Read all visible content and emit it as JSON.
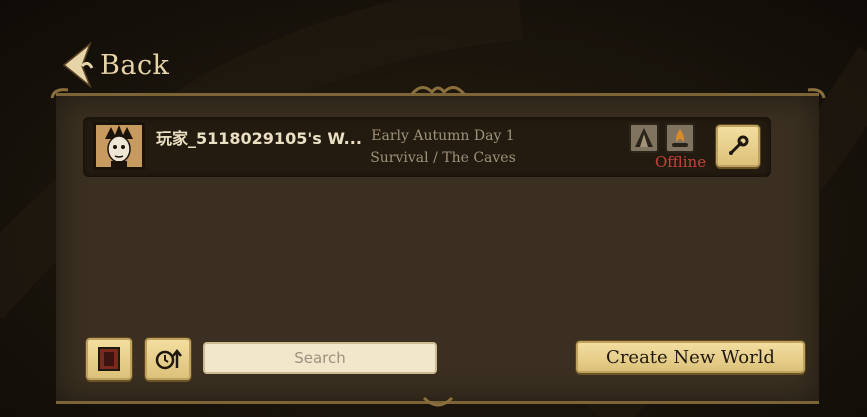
{
  "back": {
    "label": "Back"
  },
  "world": {
    "name": "玩家_5118029105's W...",
    "season": "Early Autumn Day 1",
    "mode": "Survival / The Caves",
    "status": "Offline"
  },
  "search": {
    "placeholder": "Search"
  },
  "create": {
    "label": "Create New World"
  },
  "colors": {
    "gold": "#e8cf8c",
    "status_offline": "#c3423a",
    "panel": "#3a2f20"
  }
}
